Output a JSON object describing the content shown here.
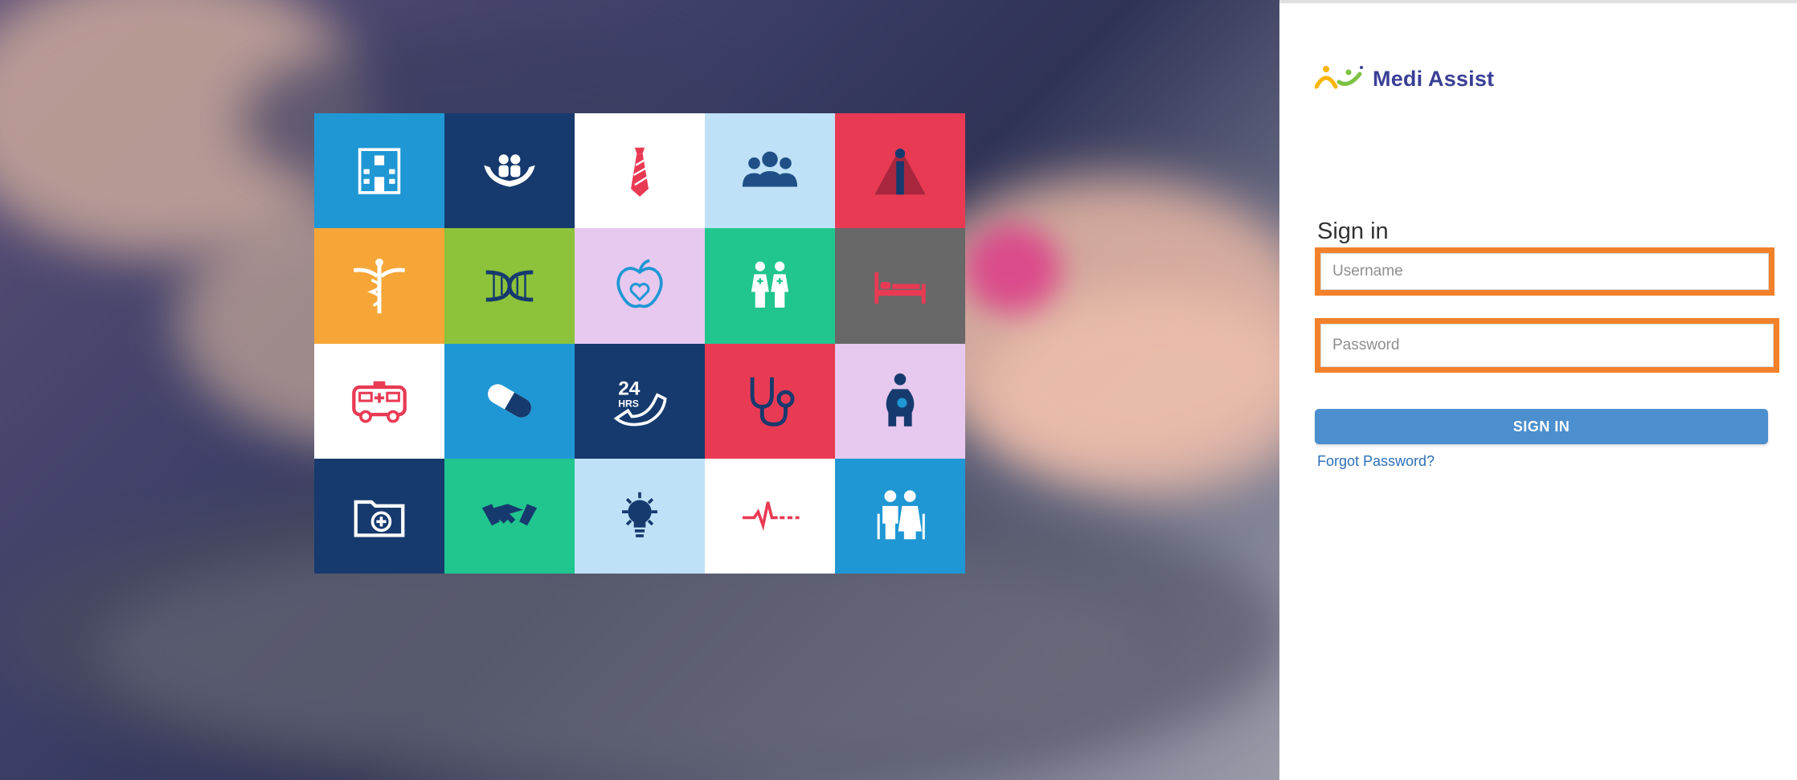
{
  "hero": {
    "tiles": [
      {
        "icon": "hospital-building-icon",
        "bg": "#1f97d4"
      },
      {
        "icon": "family-care-hands-icon",
        "bg": "#163a6e"
      },
      {
        "icon": "tie-icon",
        "bg": "#ffffff"
      },
      {
        "icon": "group-people-icon",
        "bg": "#bfe1f7"
      },
      {
        "icon": "info-pyramid-icon",
        "bg": "#e93a54"
      },
      {
        "icon": "caduceus-icon",
        "bg": "#f6a637"
      },
      {
        "icon": "dna-icon",
        "bg": "#8cc33a"
      },
      {
        "icon": "apple-heart-icon",
        "bg": "#e7c8ef"
      },
      {
        "icon": "nurses-icon",
        "bg": "#21c58e"
      },
      {
        "icon": "hospital-bed-icon",
        "bg": "#686868"
      },
      {
        "icon": "ambulance-icon",
        "bg": "#ffffff"
      },
      {
        "icon": "pill-capsule-icon",
        "bg": "#1f97d4"
      },
      {
        "icon": "24-hours-phone-icon",
        "bg": "#163a6e",
        "text": "24",
        "subtext": "HRS"
      },
      {
        "icon": "stethoscope-icon",
        "bg": "#e93a54"
      },
      {
        "icon": "pregnant-woman-icon",
        "bg": "#e7c8ef"
      },
      {
        "icon": "medical-folder-icon",
        "bg": "#163a6e"
      },
      {
        "icon": "handshake-icon",
        "bg": "#21c58e"
      },
      {
        "icon": "lightbulb-icon",
        "bg": "#bfe1f7"
      },
      {
        "icon": "heartbeat-icon",
        "bg": "#ffffff"
      },
      {
        "icon": "elderly-couple-icon",
        "bg": "#1f97d4"
      }
    ]
  },
  "brand": {
    "name": "Medi Assist",
    "color": "#3a3f96"
  },
  "form": {
    "title": "Sign in",
    "username_placeholder": "Username",
    "password_placeholder": "Password",
    "submit_label": "SIGN IN",
    "forgot_label": "Forgot Password?",
    "highlight_color": "#f2812a",
    "button_color": "#4c8fce"
  }
}
